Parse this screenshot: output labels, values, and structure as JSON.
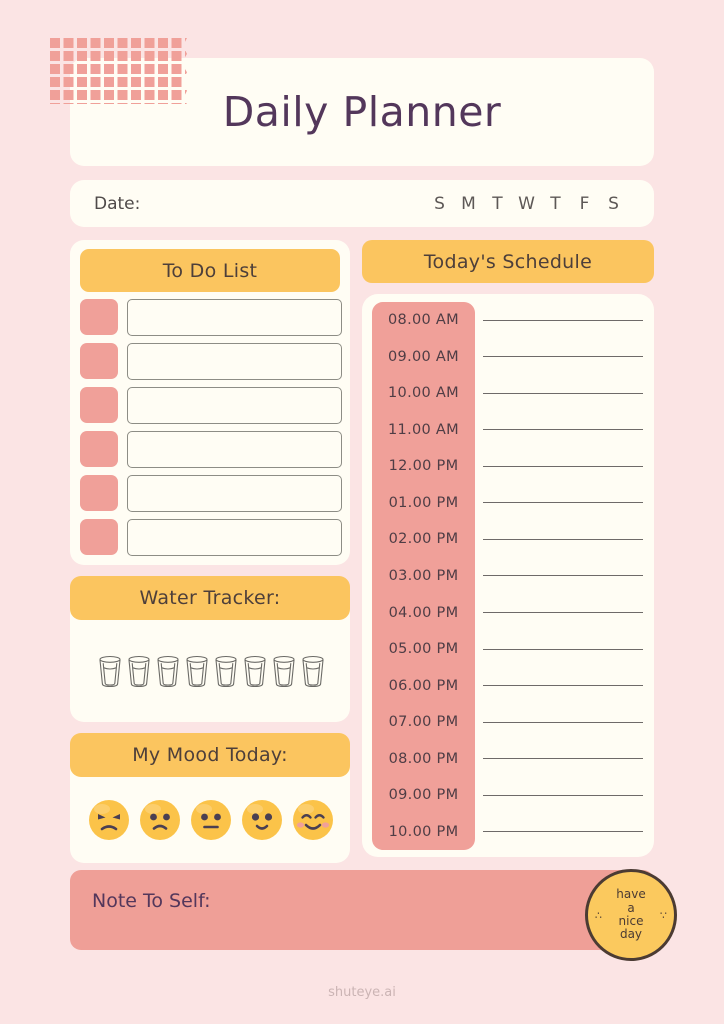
{
  "header": {
    "title": "Daily Planner",
    "date_label": "Date:",
    "weekdays": [
      "S",
      "M",
      "T",
      "W",
      "T",
      "F",
      "S"
    ]
  },
  "todo": {
    "heading": "To Do List",
    "rows": [
      "",
      "",
      "",
      "",
      "",
      ""
    ]
  },
  "water": {
    "heading": "Water Tracker:",
    "glass_count": 8,
    "glass_icon": "water-glass-icon"
  },
  "mood": {
    "heading": "My Mood Today:",
    "faces": [
      {
        "name": "angry-face-icon"
      },
      {
        "name": "sad-face-icon"
      },
      {
        "name": "neutral-face-icon"
      },
      {
        "name": "happy-face-icon"
      },
      {
        "name": "very-happy-face-icon"
      }
    ]
  },
  "schedule": {
    "heading": "Today's Schedule",
    "times": [
      "08.00 AM",
      "09.00 AM",
      "10.00 AM",
      "11.00 AM",
      "12.00 PM",
      "01.00 PM",
      "02.00 PM",
      "03.00 PM",
      "04.00 PM",
      "05.00 PM",
      "06.00 PM",
      "07.00 PM",
      "08.00 PM",
      "09.00 PM",
      "10.00 PM"
    ]
  },
  "note": {
    "label": "Note To Self:"
  },
  "stamp": {
    "line1": "have",
    "line2": "a",
    "line3": "nice",
    "line4": "day",
    "dots_left": "∴",
    "dots_right": "∵"
  },
  "footer": {
    "text": "shuteye.ai"
  },
  "colors": {
    "page_background": "#fbe4e4",
    "card_cream": "#fffdf4",
    "accent_yellow": "#fbc55f",
    "accent_pink": "#f0a099",
    "note_pink": "#ef9f97",
    "title_purple": "#53375b",
    "heading_text": "#4d3f3a"
  }
}
